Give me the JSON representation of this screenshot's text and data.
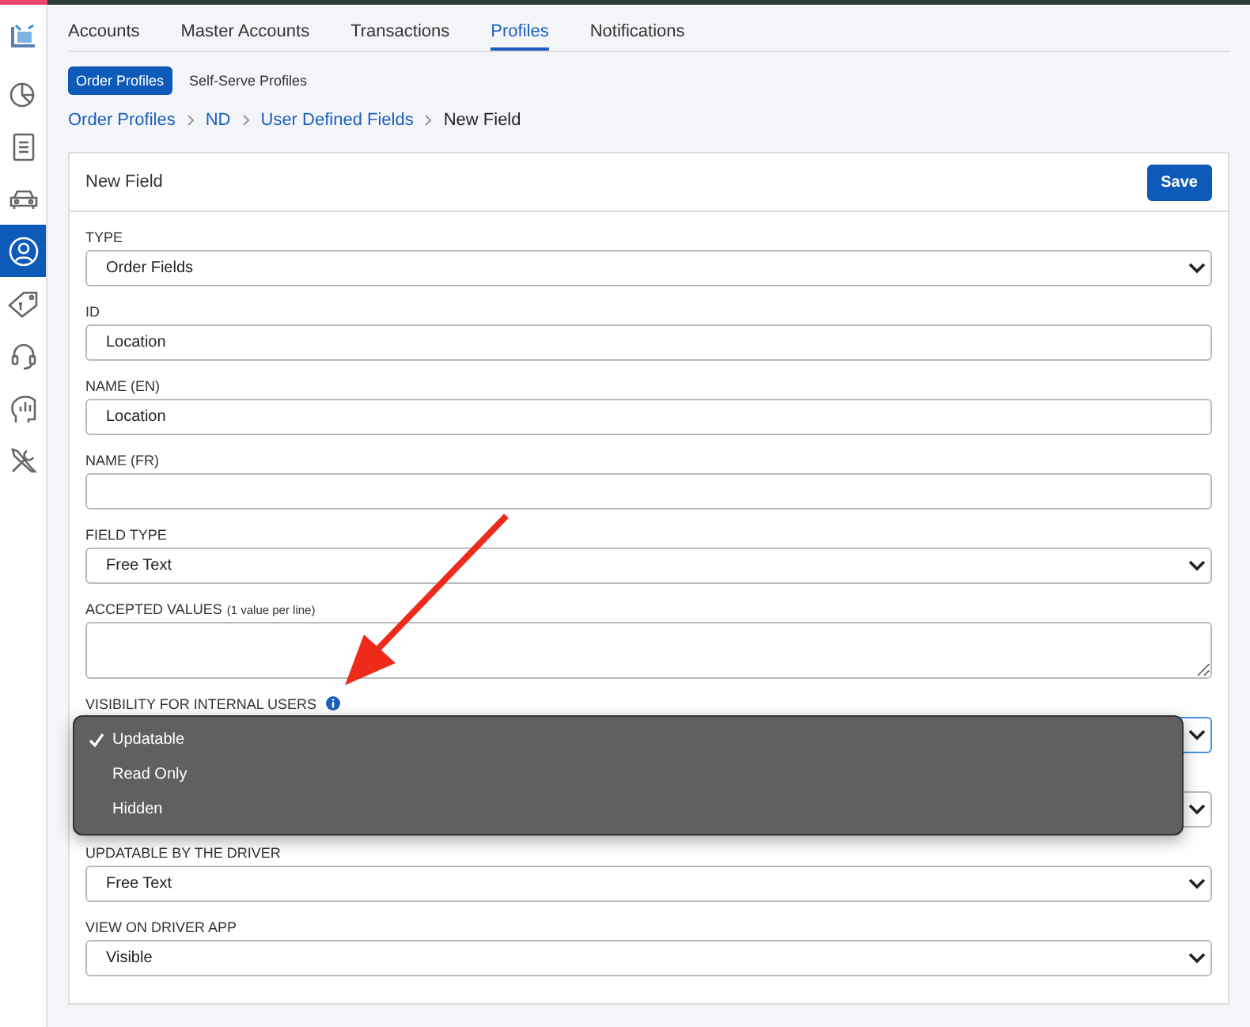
{
  "sidebar": {
    "items": [
      {
        "selected": false
      },
      {
        "selected": false
      },
      {
        "selected": false
      },
      {
        "selected": false
      },
      {
        "selected": true
      },
      {
        "selected": false
      },
      {
        "selected": false
      },
      {
        "selected": false
      },
      {
        "selected": false
      }
    ]
  },
  "tabs": [
    {
      "label": "Accounts",
      "selected": false
    },
    {
      "label": "Master Accounts",
      "selected": false
    },
    {
      "label": "Transactions",
      "selected": false
    },
    {
      "label": "Profiles",
      "selected": true
    },
    {
      "label": "Notifications",
      "selected": false
    }
  ],
  "subtabs": [
    {
      "label": "Order Profiles",
      "selected": true
    },
    {
      "label": "Self-Serve Profiles",
      "selected": false
    }
  ],
  "breadcrumb": [
    {
      "label": "Order Profiles",
      "link": true
    },
    {
      "label": "ND",
      "link": true
    },
    {
      "label": "User Defined Fields",
      "link": true
    },
    {
      "label": "New Field",
      "link": false
    }
  ],
  "card": {
    "title": "New Field",
    "save_button": "Save"
  },
  "fields": [
    {
      "kind": "select",
      "label": "TYPE",
      "value": "Order Fields"
    },
    {
      "kind": "input",
      "label": "ID",
      "value": "Location"
    },
    {
      "kind": "input",
      "label": "NAME (EN)",
      "value": "Location"
    },
    {
      "kind": "input",
      "label": "NAME (FR)"
    },
    {
      "kind": "select",
      "label": "FIELD TYPE",
      "value": "Free Text"
    },
    {
      "kind": "textarea",
      "label": "ACCEPTED VALUES",
      "hint": "(1 value per line)"
    },
    {
      "kind": "select",
      "label": "VISIBILITY FOR INTERNAL USERS",
      "info": true,
      "focused": true
    },
    {
      "kind": "select"
    },
    {
      "kind": "select",
      "label": "UPDATABLE BY THE DRIVER",
      "value": "Free Text"
    },
    {
      "kind": "select",
      "label": "VIEW ON DRIVER APP",
      "value": "Visible"
    }
  ],
  "dropdown_menu": {
    "options": [
      {
        "label": "Updatable",
        "selected": true
      },
      {
        "label": "Read Only",
        "selected": false
      },
      {
        "label": "Hidden",
        "selected": false
      }
    ]
  }
}
